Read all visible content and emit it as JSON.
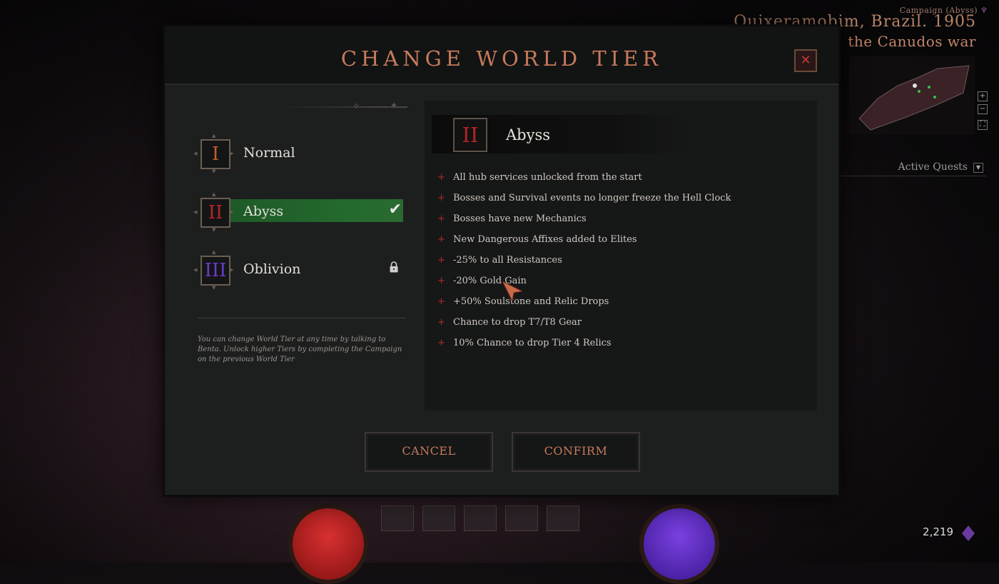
{
  "hud": {
    "campaign_label": "Campaign (Abyss)",
    "location": "Quixeramobim, Brazil. 1905",
    "sublocation": "the Canudos war",
    "active_quests": "Active Quests",
    "currency_value": "2,219",
    "minimap_controls": [
      "+",
      "−",
      "⛶"
    ]
  },
  "modal": {
    "title": "CHANGE WORLD TIER",
    "close_glyph": "✕",
    "tiers": [
      {
        "numeral": "I",
        "name": "Normal",
        "color": "#c0602e",
        "selected": false,
        "locked": false
      },
      {
        "numeral": "II",
        "name": "Abyss",
        "color": "#b02626",
        "selected": true,
        "locked": false
      },
      {
        "numeral": "III",
        "name": "Oblivion",
        "color": "#6a3acc",
        "selected": false,
        "locked": true
      }
    ],
    "check_glyph": "✔",
    "hint": "You can change World Tier at any time by talking to Benta. Unlock higher Tiers by completing the Campaign on the previous World Tier",
    "detail": {
      "numeral": "II",
      "title": "Abyss",
      "features": [
        "All hub services unlocked from the start",
        "Bosses and Survival events no longer freeze the Hell Clock",
        "Bosses have new Mechanics",
        "New Dangerous Affixes added to Elites",
        "-25% to all Resistances",
        "-20% Gold Gain",
        "+50% Soulstone and Relic Drops",
        "Chance to drop T7/T8 Gear",
        "10% Chance to drop Tier 4 Relics"
      ],
      "bullet_glyph": "+"
    },
    "cancel_label": "CANCEL",
    "confirm_label": "CONFIRM"
  }
}
